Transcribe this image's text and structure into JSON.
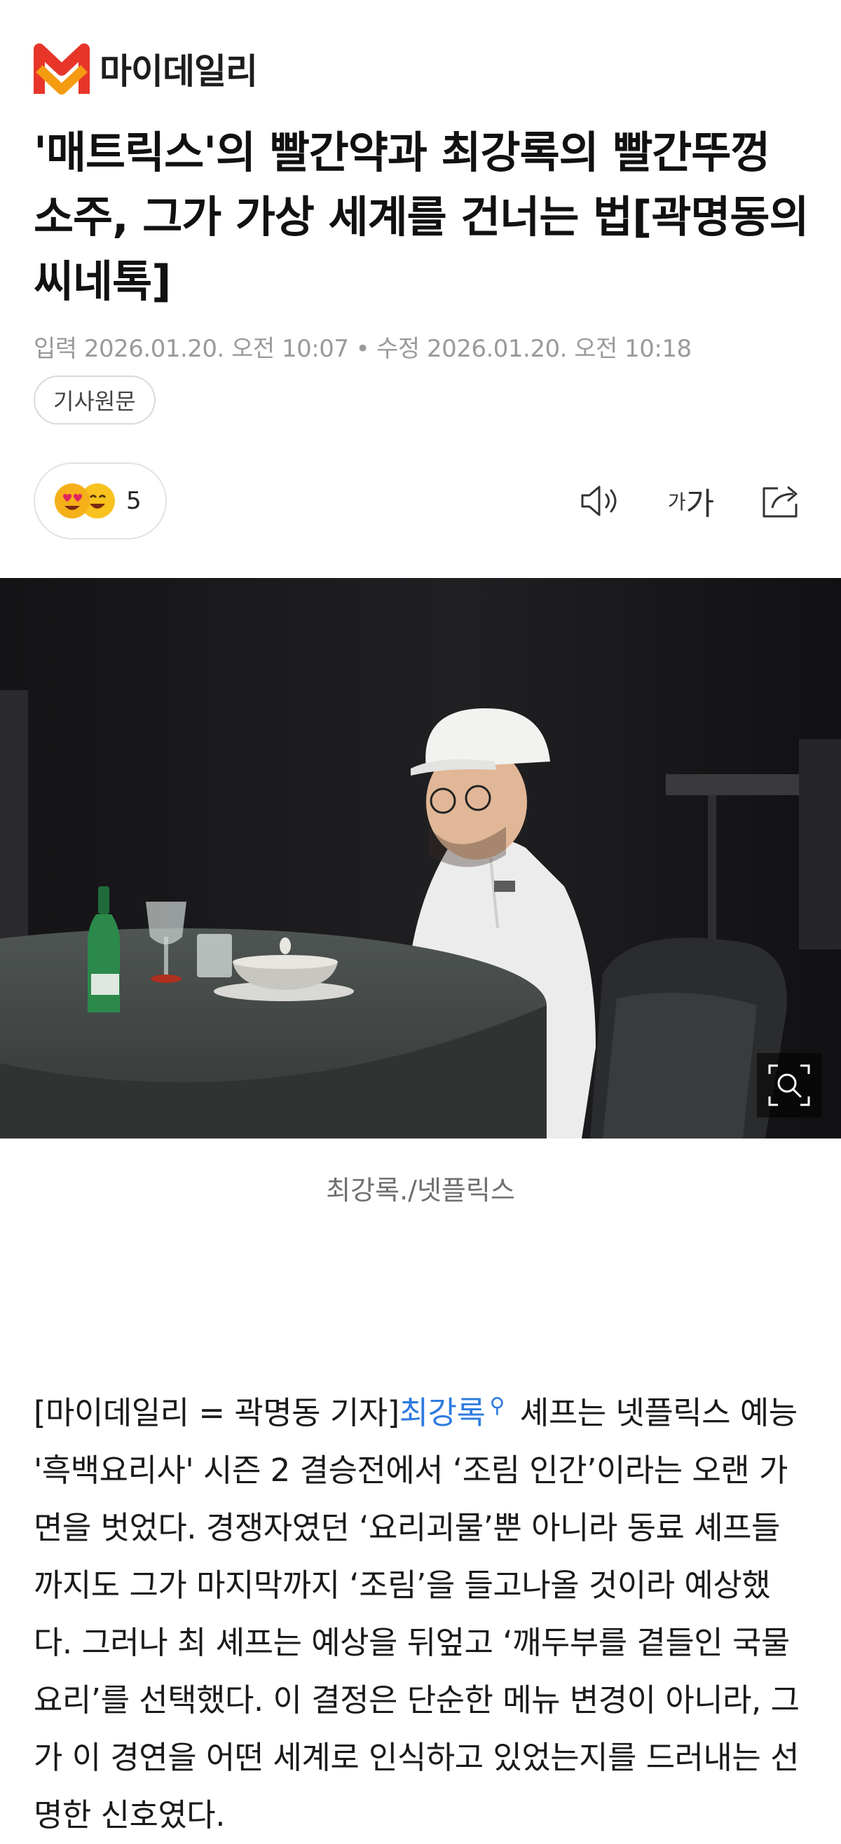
{
  "header": {
    "logo_text": "마이데일리",
    "brand_colors": {
      "red": "#e8352a",
      "orange": "#f59b12"
    }
  },
  "article": {
    "title": "'매트릭스'의 빨간약과 최강록의 빨간뚜껑 소주, 그가 가상 세계를 건너는 법[곽명동의 씨네톡]",
    "input_date": "입력 2026.01.20. 오전 10:07",
    "edit_date": "수정 2026.01.20. 오전 10:18",
    "date_separator": "•",
    "original_link_label": "기사원문",
    "reaction_count": "5",
    "reaction_icons": [
      "heart-eyes-emoji-icon",
      "smile-emoji-icon"
    ],
    "toolbar": {
      "listen_icon": "speaker-icon",
      "font_small": "가",
      "font_large": "가",
      "share_icon": "share-icon"
    },
    "photo": {
      "zoom_icon": "zoom-search-icon",
      "caption": "최강록./넷플릭스"
    },
    "body": {
      "lead": "[마이데일리 = 곽명동 기자]",
      "linked_name": "최강록",
      "search_hint_icon": "mini-search-icon",
      "rest": "셰프는 넷플릭스 예능 '흑백요리사' 시즌 2 결승전에서 ‘조림 인간’이라는 오랜 가면을 벗었다. 경쟁자였던 ‘요리괴물’뿐 아니라 동료 셰프들까지도 그가 마지막까지 ‘조림’을 들고나올 것이라 예상했다. 그러나 최 셰프는 예상을 뒤엎고 ‘깨두부를 곁들인 국물 요리’를 선택했다. 이 결정은 단순한 메뉴 변경이 아니라, 그가 이 경연을 어떤 세계로 인식하고 있었는지를 드러내는 선명한 신호였다."
    },
    "link_color": "#2f7be0"
  }
}
